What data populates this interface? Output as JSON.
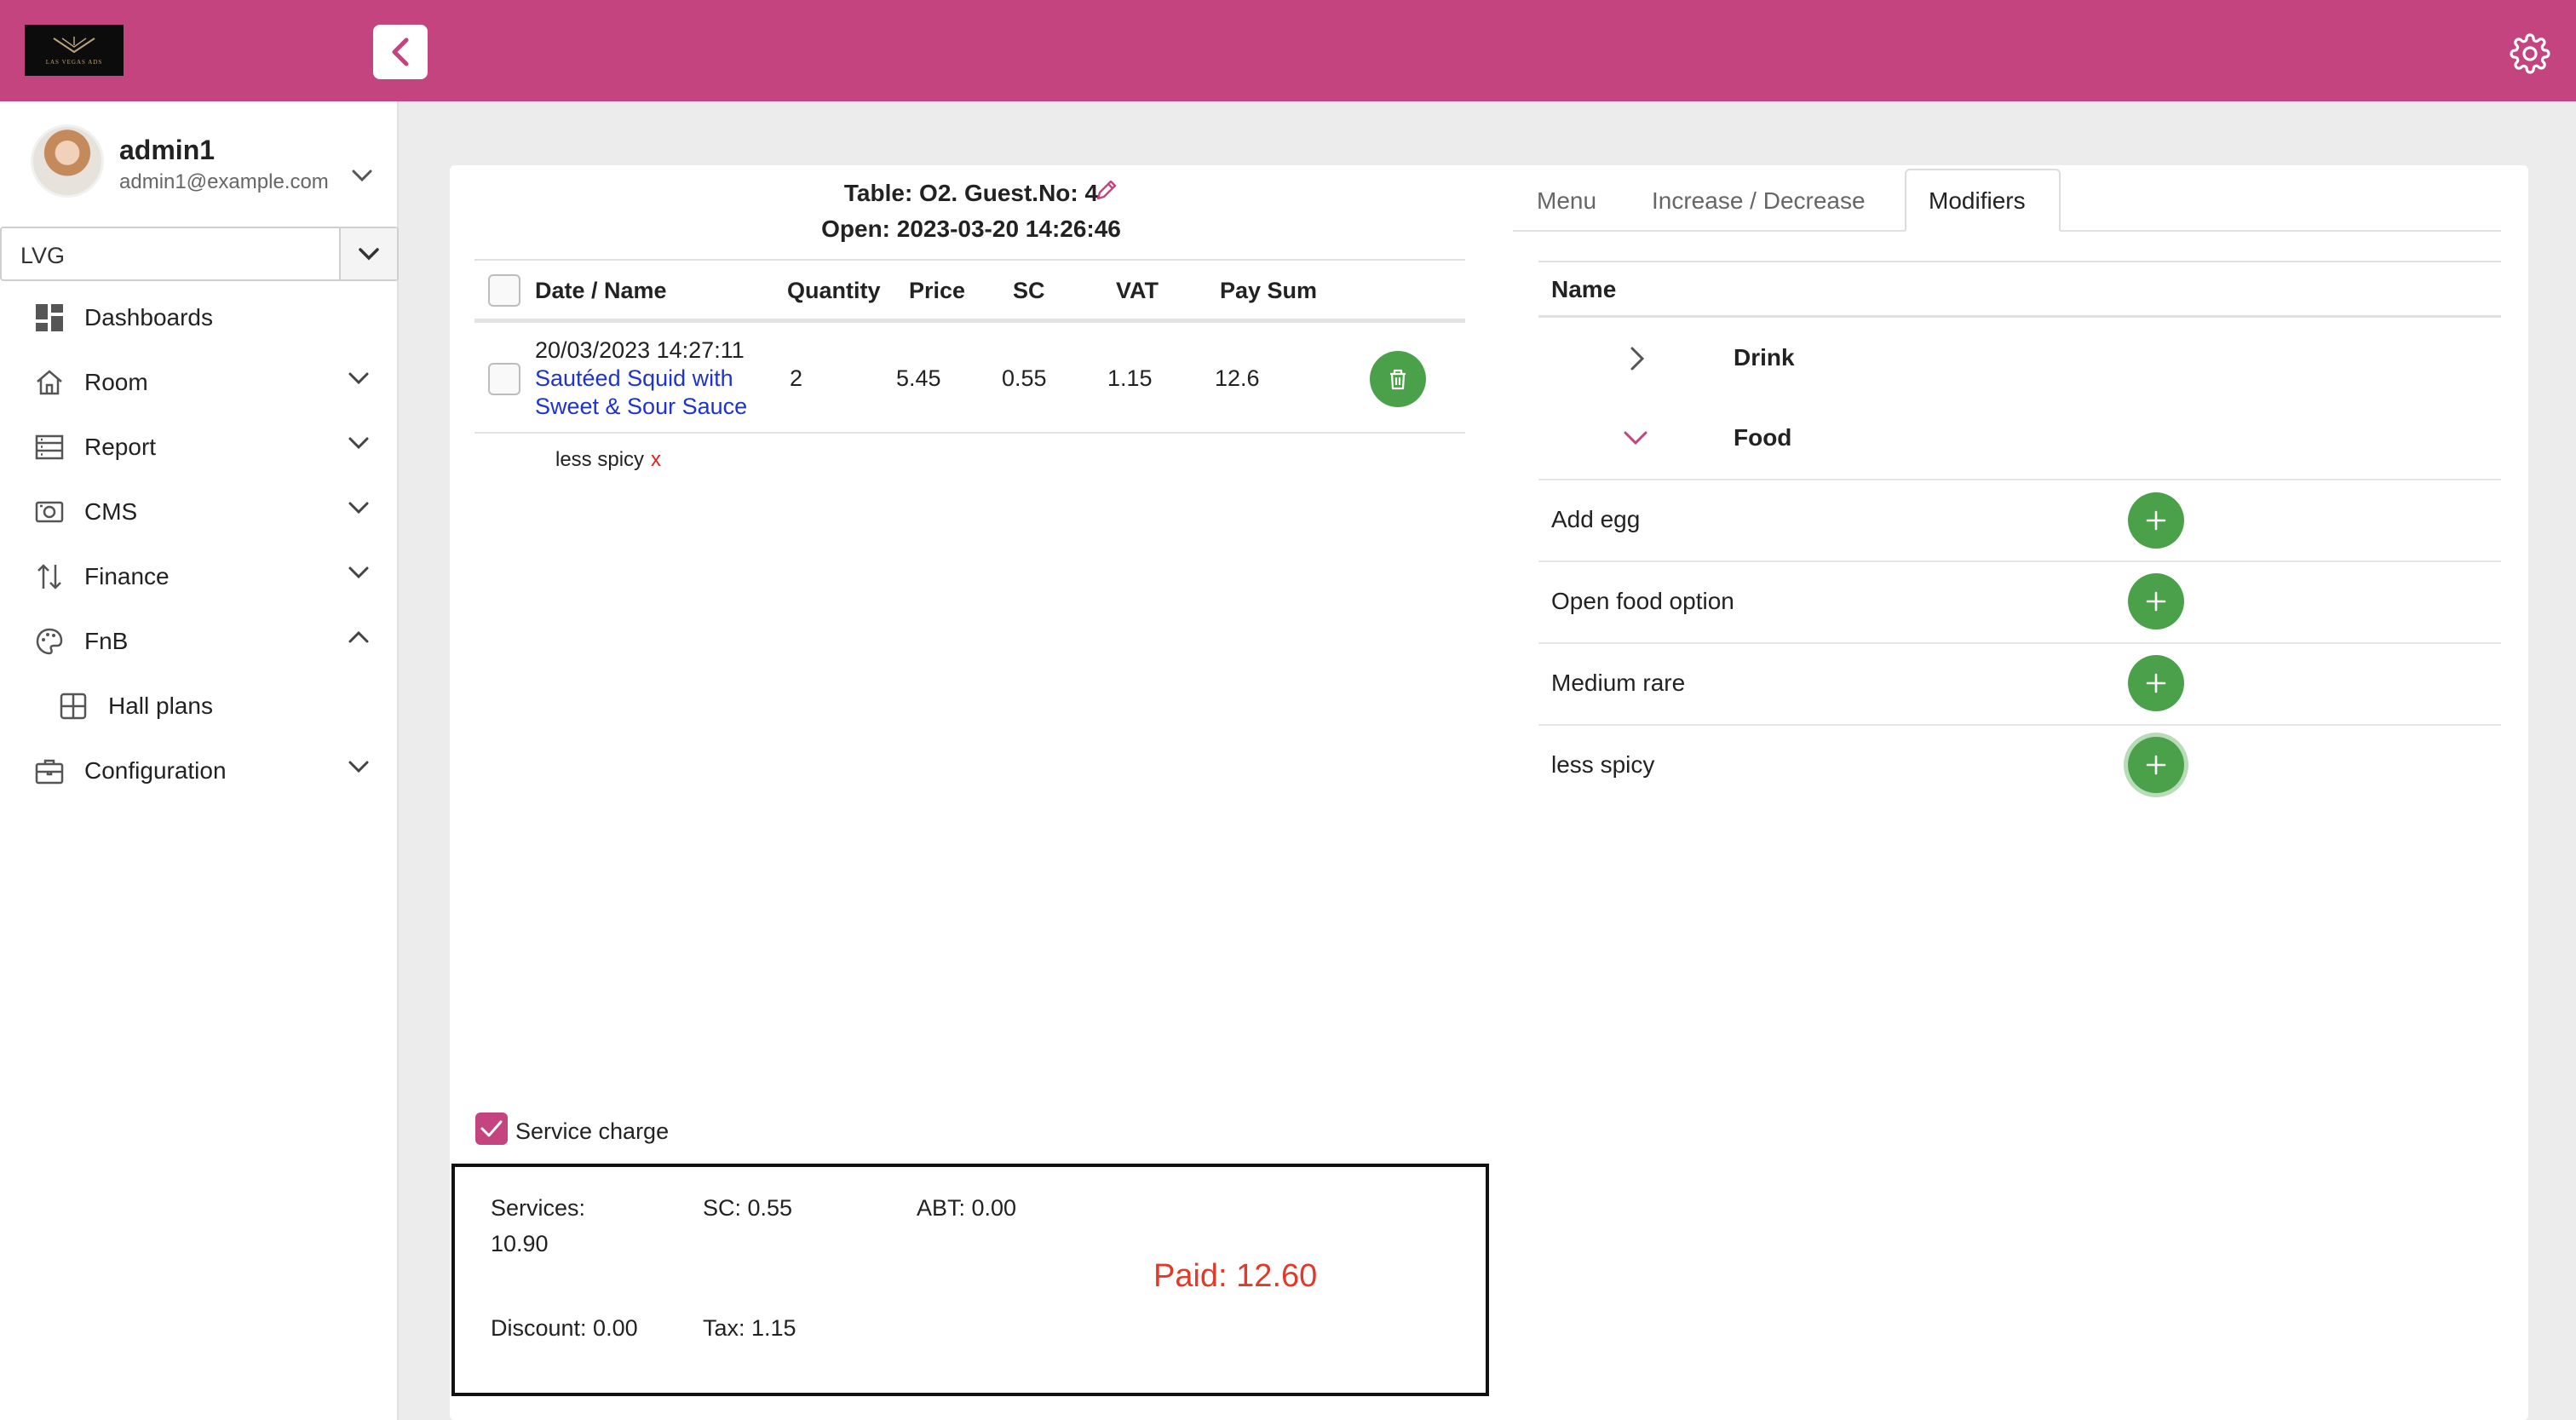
{
  "brand": {
    "logo_text": "LAS VEGAS ADS"
  },
  "user": {
    "name": "admin1",
    "email": "admin1@example.com"
  },
  "org_select": {
    "value": "LVG"
  },
  "nav": [
    {
      "label": "Dashboards",
      "icon": "dashboard-icon"
    },
    {
      "label": "Room",
      "icon": "home-icon"
    },
    {
      "label": "Report",
      "icon": "report-icon"
    },
    {
      "label": "CMS",
      "icon": "cms-icon"
    },
    {
      "label": "Finance",
      "icon": "finance-icon"
    },
    {
      "label": "FnB",
      "icon": "palette-icon"
    },
    {
      "label": "Hall plans",
      "icon": "grid-icon"
    },
    {
      "label": "Configuration",
      "icon": "briefcase-icon"
    }
  ],
  "order": {
    "table_line": "Table: O2. Guest.No: 4",
    "open_line": "Open: 2023-03-20 14:26:46",
    "columns": [
      "Date / Name",
      "Quantity",
      "Price",
      "SC",
      "VAT",
      "Pay Sum"
    ],
    "items": [
      {
        "datetime": "20/03/2023 14:27:11",
        "name_line1": "Sautéed Squid with",
        "name_line2": "Sweet & Sour Sauce",
        "quantity": "2",
        "price": "5.45",
        "sc": "0.55",
        "vat": "1.15",
        "pay_sum": "12.6",
        "modifier": "less spicy",
        "modifier_remove": "x"
      }
    ],
    "service_charge_label": "Service charge",
    "service_charge_checked": true
  },
  "summary": {
    "services": "Services:",
    "services_value": "10.90",
    "sc": "SC: 0.55",
    "abt": "ABT: 0.00",
    "discount": "Discount: 0.00",
    "tax": "Tax: 1.15",
    "paid": "Paid: 12.60"
  },
  "tabs": [
    {
      "label": "Menu",
      "active": false
    },
    {
      "label": "Increase / Decrease",
      "active": false
    },
    {
      "label": "Modifiers",
      "active": true
    }
  ],
  "modifiers": {
    "column": "Name",
    "groups": [
      {
        "name": "Drink",
        "expanded": false
      },
      {
        "name": "Food",
        "expanded": true
      }
    ],
    "items": [
      "Add egg",
      "Open food option",
      "Medium rare",
      "less spicy"
    ]
  },
  "colors": {
    "brand": "#c44480",
    "accent_green": "#4aa14a",
    "paid_red": "#e03a2a",
    "link_blue": "#1f33d0"
  }
}
